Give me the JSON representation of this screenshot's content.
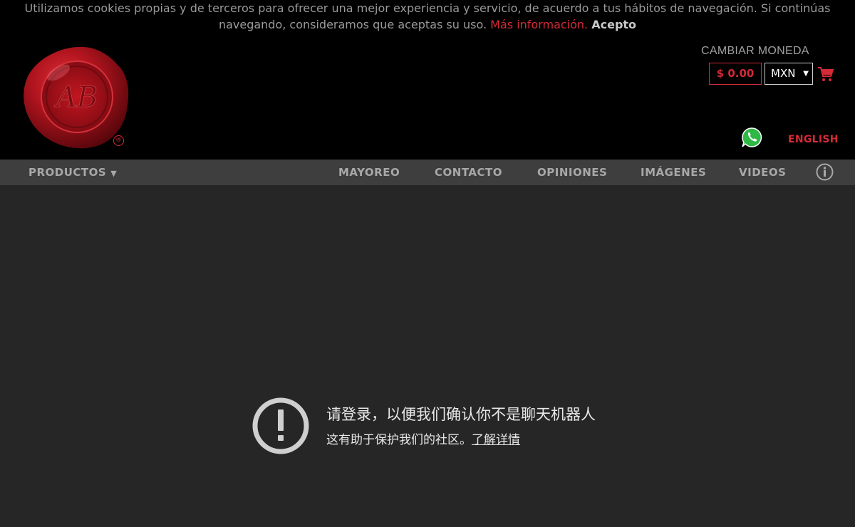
{
  "cookie_bar": {
    "line1": "Utilizamos cookies propias y de terceros para ofrecer una mejor experiencia y servicio, de acuerdo a tus hábitos de navegación. Si continúas",
    "line2_prefix": "navegando, consideramos que aceptas su uso.",
    "more_info": "Más información.",
    "accept": "Acepto"
  },
  "header": {
    "logo_mark": "®",
    "currency_title": "CAMBIAR MONEDA",
    "cart_total": "$ 0.00",
    "currency_selected": "MXN",
    "language_link": "ENGLISH",
    "icons": [
      "whatsapp-icon",
      "cart-icon",
      "wax-seal-logo"
    ]
  },
  "nav": {
    "products": "PRODUCTOS",
    "wholesale": "MAYOREO",
    "contact": "CONTACTO",
    "reviews": "OPINIONES",
    "images": "IMÁGENES",
    "videos": "VIDEOS"
  },
  "alert": {
    "title": "请登录，以便我们确认你不是聊天机器人",
    "body": "这有助于保护我们的社区。",
    "link": "了解详情"
  },
  "colors": {
    "accent_red": "#d52a37",
    "header_bg": "#000000",
    "nav_bg": "#3e3e3e",
    "main_bg": "#262626"
  }
}
